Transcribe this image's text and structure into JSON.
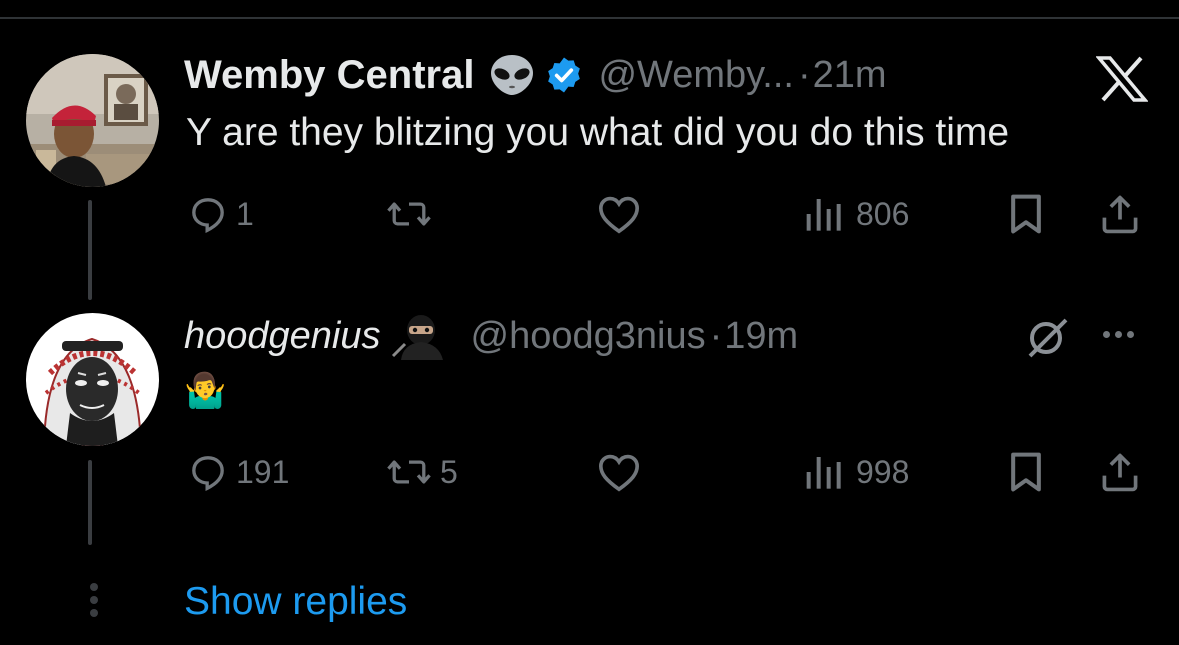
{
  "tweet1": {
    "display_name": "Wemby Central",
    "handle": "@Wemby...",
    "time": "21m",
    "text": "Y are they blitzing you what did you do this time",
    "stats": {
      "replies": "1",
      "views": "806"
    }
  },
  "tweet2": {
    "display_name": "hoodgenius",
    "handle": "@hoodg3nius",
    "time": "19m",
    "emoji": "🤷‍♂️",
    "stats": {
      "replies": "191",
      "retweets": "5",
      "views": "998"
    }
  },
  "separator": "·",
  "show_replies_label": "Show replies",
  "colors": {
    "background": "#000000",
    "text": "#e7e9ea",
    "muted": "#71767b",
    "accent": "#1d9bf0"
  },
  "icons": [
    "alien-emoji",
    "verified-badge-icon",
    "x-logo-icon",
    "ninja-emoji",
    "grok-icon",
    "more-icon",
    "reply-icon",
    "retweet-icon",
    "like-icon",
    "views-icon",
    "bookmark-icon",
    "share-icon"
  ]
}
